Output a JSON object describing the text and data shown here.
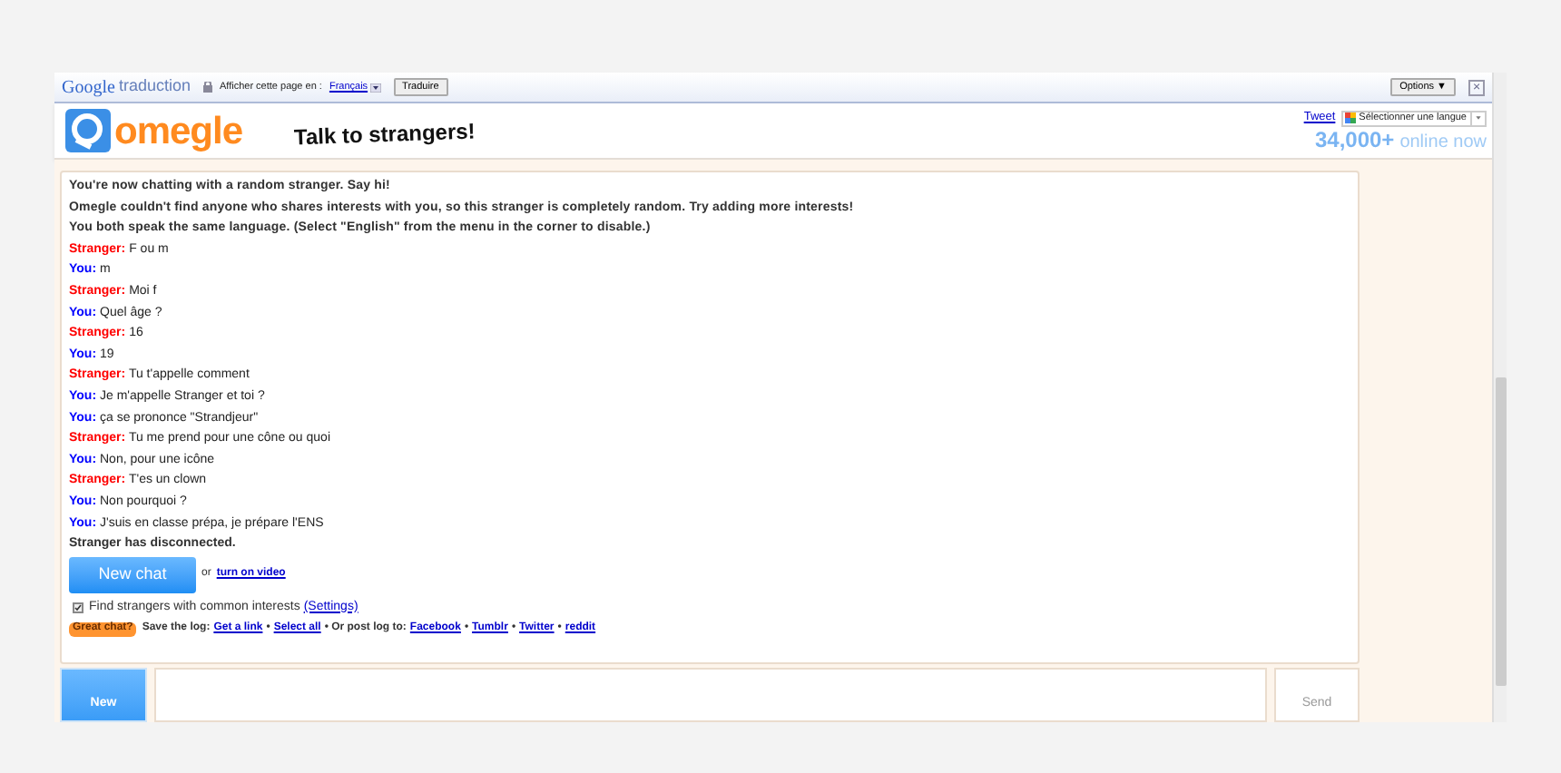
{
  "translate_bar": {
    "logo": "Google",
    "product": "traduction",
    "prompt": "Afficher cette page en :",
    "language": "Français",
    "translate_button": "Traduire",
    "options_button": "Options ▼",
    "close": "×"
  },
  "header": {
    "logo": "omegle",
    "tagline": "Talk to strangers!",
    "tweet": "Tweet",
    "language_select": "Sélectionner une langue",
    "online_count": "34,000+",
    "online_label": "online now"
  },
  "chat": {
    "messages": [
      {
        "kind": "system",
        "text": "You're now chatting with a random stranger. Say hi!"
      },
      {
        "kind": "system",
        "text": "Omegle couldn't find anyone who shares interests with you, so this stranger is completely random. Try adding more interests!"
      },
      {
        "kind": "system",
        "text": "You both speak the same language. (Select \"English\" from the menu in the corner to disable.)"
      },
      {
        "kind": "stranger",
        "speaker": "Stranger:",
        "text": "F ou m"
      },
      {
        "kind": "you",
        "speaker": "You:",
        "text": "m"
      },
      {
        "kind": "stranger",
        "speaker": "Stranger:",
        "text": "Moi f"
      },
      {
        "kind": "you",
        "speaker": "You:",
        "text": "Quel âge ?"
      },
      {
        "kind": "stranger",
        "speaker": "Stranger:",
        "text": "16"
      },
      {
        "kind": "you",
        "speaker": "You:",
        "text": "19"
      },
      {
        "kind": "stranger",
        "speaker": "Stranger:",
        "text": "Tu t'appelle comment"
      },
      {
        "kind": "you",
        "speaker": "You:",
        "text": "Je m'appelle Stranger et toi ?"
      },
      {
        "kind": "you",
        "speaker": "You:",
        "text": "ça se prononce \"Strandjeur\""
      },
      {
        "kind": "stranger",
        "speaker": "Stranger:",
        "text": "Tu me prend pour une cône ou quoi"
      },
      {
        "kind": "you",
        "speaker": "You:",
        "text": "Non, pour une icône"
      },
      {
        "kind": "stranger",
        "speaker": "Stranger:",
        "text": "T'es un clown"
      },
      {
        "kind": "you",
        "speaker": "You:",
        "text": "Non pourquoi ?"
      },
      {
        "kind": "you",
        "speaker": "You:",
        "text": "J'suis en classe prépa, je prépare l'ENS"
      },
      {
        "kind": "status",
        "text": "Stranger has disconnected."
      }
    ],
    "new_chat_button": "New chat",
    "or": "or",
    "video_link": "turn on video",
    "interests": {
      "label": "Find strangers with common interests",
      "checked": true,
      "settings_link": "(Settings)"
    },
    "great_chat": "Great chat?",
    "save_log": "Save the log:",
    "get_link": "Get a link",
    "sep_1": "•",
    "select_all": "Select all",
    "post_log": "• Or post log to:",
    "share_links": [
      "Facebook",
      "Tumblr",
      "Twitter",
      "reddit"
    ]
  },
  "composer": {
    "new_button": "New",
    "send_button": "Send"
  }
}
